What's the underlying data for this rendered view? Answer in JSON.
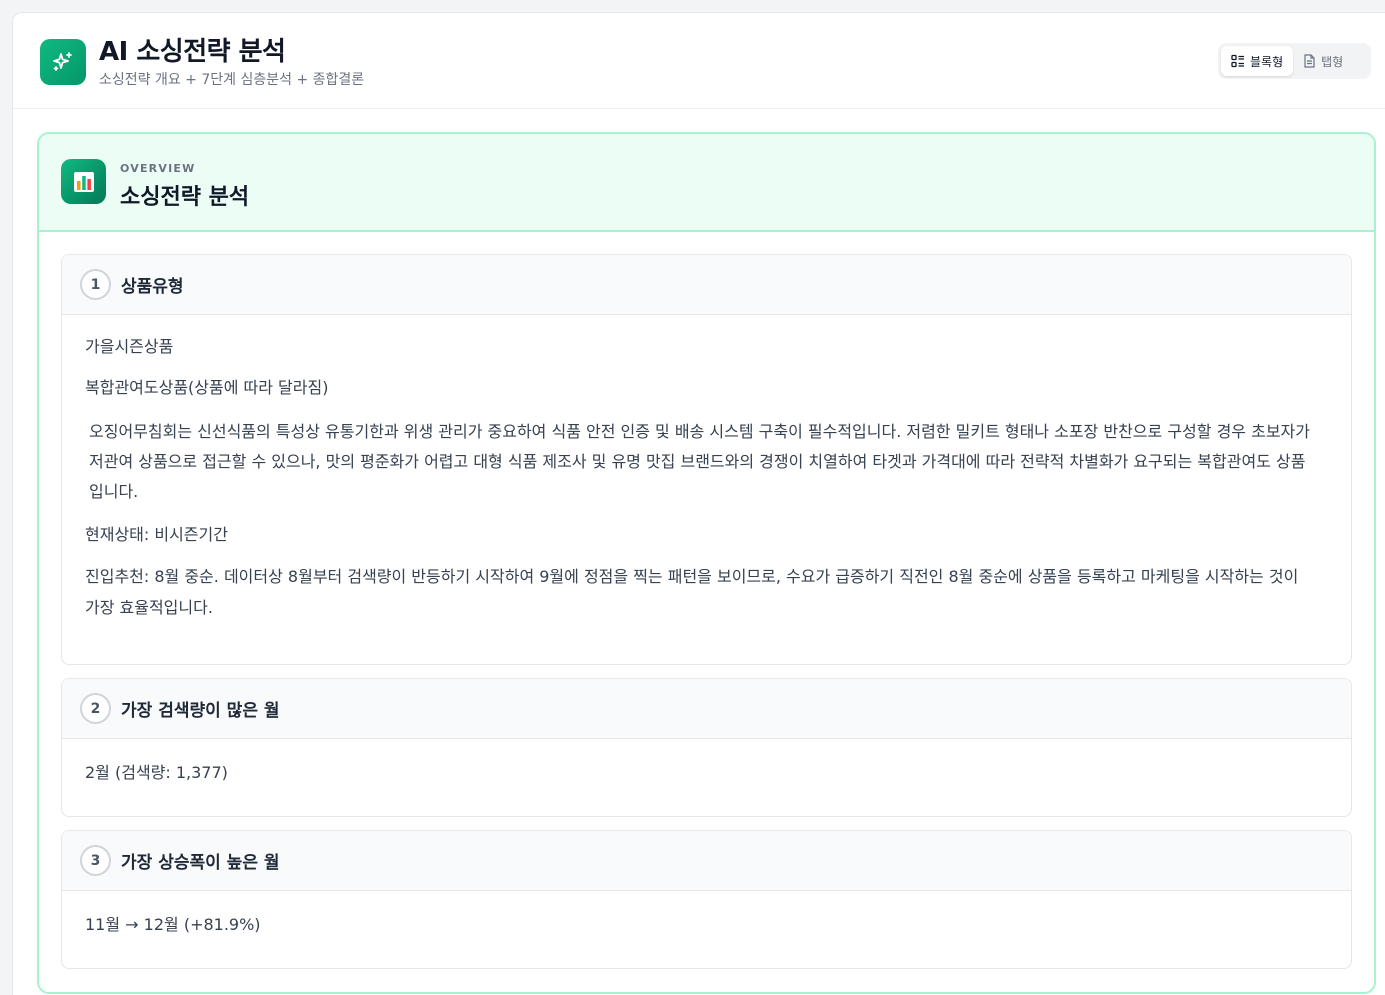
{
  "header": {
    "title": "AI 소싱전략 분석",
    "subtitle": "소싱전략 개요 + 7단계 심층분석 + 종합결론",
    "logo_icon": "sparkles-icon"
  },
  "view_toggle": {
    "block_label": "블록형",
    "tab_label": "탭형",
    "active": "block"
  },
  "overview": {
    "eyebrow": "OVERVIEW",
    "title": "소싱전략 분석",
    "icon": "bar-chart-icon"
  },
  "sections": [
    {
      "number": "1",
      "title": "상품유형",
      "lines": [
        "가을시즌상품",
        "복합관여도상품(상품에 따라 달라짐)"
      ],
      "description": "오징어무침회는 신선식품의 특성상 유통기한과 위생 관리가 중요하여 식품 안전 인증 및 배송 시스템 구축이 필수적입니다. 저렴한 밀키트 형태나 소포장 반찬으로 구성할 경우 초보자가 저관여 상품으로 접근할 수 있으나, 맛의 평준화가 어렵고 대형 식품 제조사 및 유명 맛집 브랜드와의 경쟁이 치열하여 타겟과 가격대에 따라 전략적 차별화가 요구되는 복합관여도 상품입니다.",
      "status": "현재상태: 비시즌기간",
      "recommendation": "진입추천: 8월 중순. 데이터상 8월부터 검색량이 반등하기 시작하여 9월에 정점을 찍는 패턴을 보이므로, 수요가 급증하기 직전인 8월 중순에 상품을 등록하고 마케팅을 시작하는 것이 가장 효율적입니다."
    },
    {
      "number": "2",
      "title": "가장 검색량이 많은 월",
      "value": "2월 (검색량: 1,377)"
    },
    {
      "number": "3",
      "title": "가장 상승폭이 높은 월",
      "value": "11월 → 12월 (+81.9%)"
    }
  ],
  "colors": {
    "accent": "#10b981",
    "overview_border": "#a7f3d0",
    "overview_bg": "#ecfdf5"
  }
}
